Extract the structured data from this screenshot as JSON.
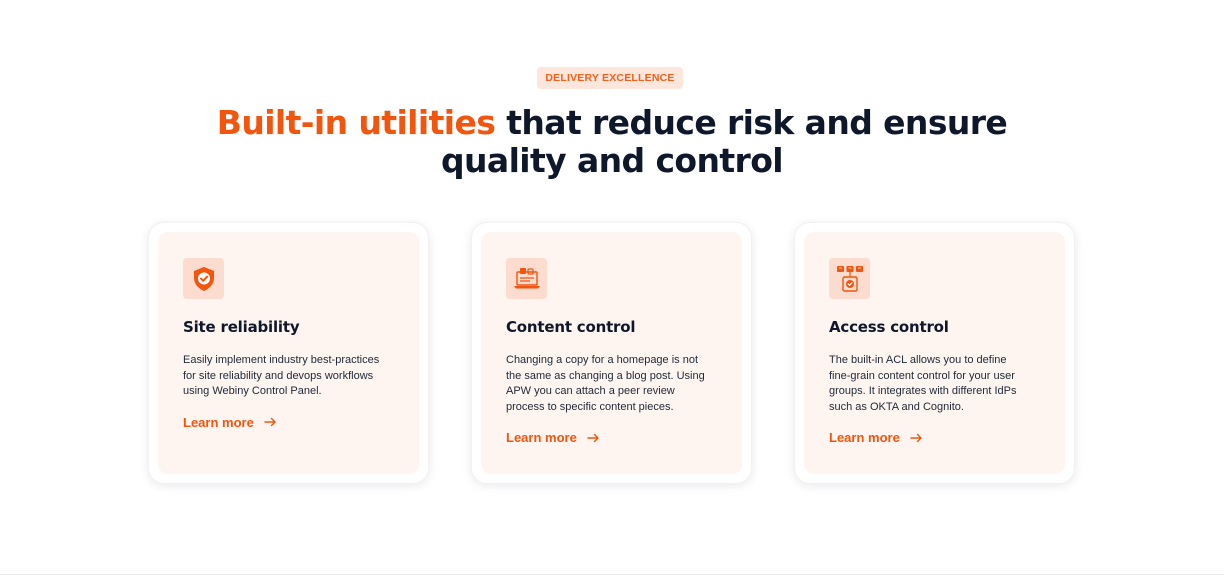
{
  "section": {
    "eyebrow": "DELIVERY EXCELLENCE",
    "headline_accent": "Built-in utilities",
    "headline_rest": " that reduce risk and ensure",
    "headline_line2": "quality and control"
  },
  "cards": [
    {
      "icon": "shield-check-icon",
      "title": "Site reliability",
      "text": "Easily implement industry best-practices\nfor site reliability and devops workflows\nusing Webiny Control Panel.",
      "link": "Learn more"
    },
    {
      "icon": "laptop-review-icon",
      "title": "Content control",
      "text": "Changing a copy for a homepage is not\nthe same as changing a blog post. Using\nAPW you can attach a peer review\nprocess to specific content pieces.",
      "link": "Learn more"
    },
    {
      "icon": "access-grid-icon",
      "title": "Access control",
      "text": "The built-in ACL allows you to define\nfine-grain content control for your user\ngroups. It integrates with different IdPs\nsuch as OKTA and Cognito.",
      "link": "Learn more"
    }
  ],
  "colors": {
    "accent": "#f2550d",
    "card_bg": "#fef4f0",
    "icon_bg": "#fbdccf",
    "heading": "#0f172a"
  }
}
